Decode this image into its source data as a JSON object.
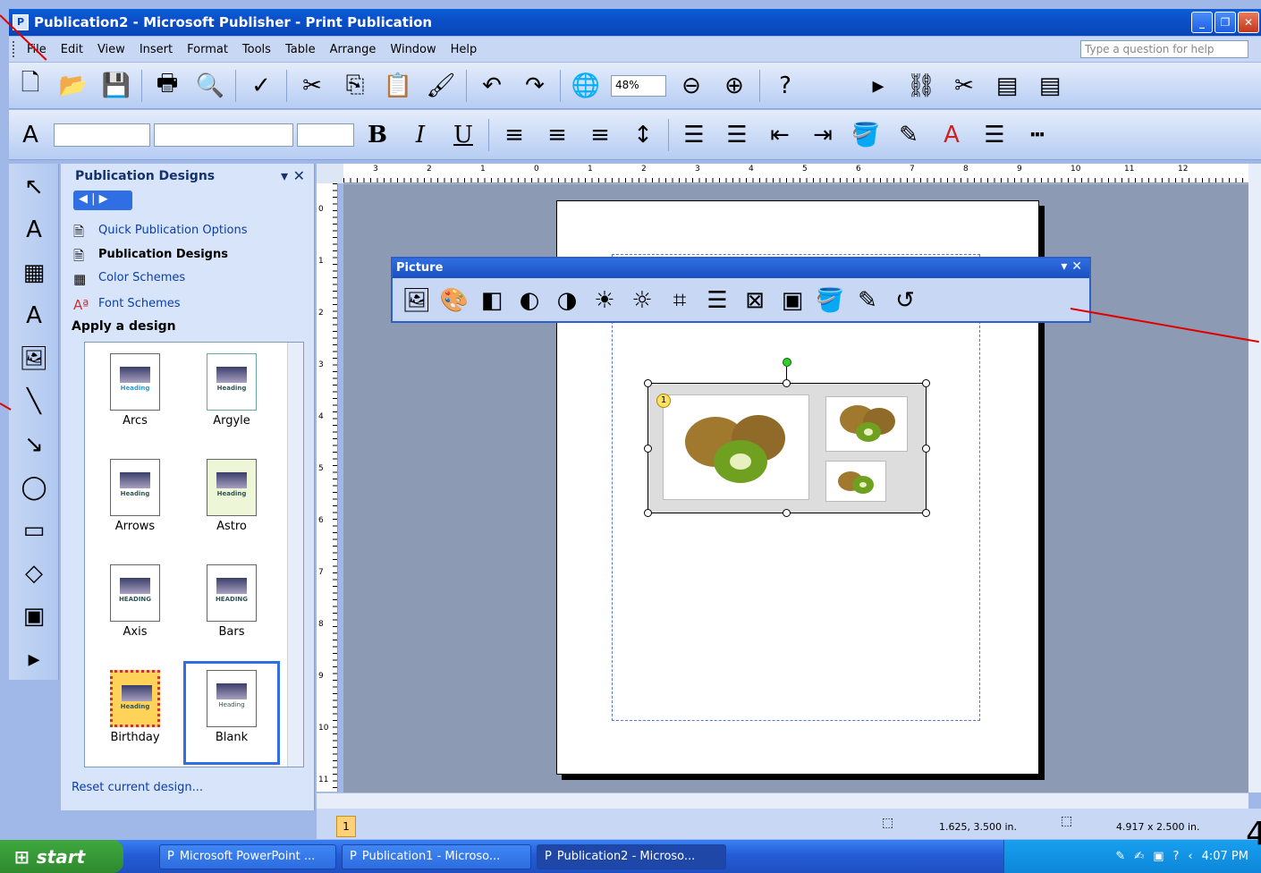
{
  "window": {
    "title": "Publication2 - Microsoft Publisher - Print Publication",
    "app_icon": "publisher-icon"
  },
  "menu": {
    "items": [
      "File",
      "Edit",
      "View",
      "Insert",
      "Format",
      "Tools",
      "Table",
      "Arrange",
      "Window",
      "Help"
    ],
    "help_placeholder": "Type a question for help"
  },
  "standard_toolbar": {
    "zoom": "48%"
  },
  "formatting_toolbar": {
    "bold": "B",
    "italic": "I",
    "underline": "U"
  },
  "task_pane": {
    "title": "Publication Designs",
    "links": [
      "Quick Publication Options",
      "Publication Designs",
      "Color Schemes",
      "Font Schemes"
    ],
    "section": "Apply a design",
    "designs": [
      "Arcs",
      "Argyle",
      "Arrows",
      "Astro",
      "Axis",
      "Bars",
      "Birthday",
      "Blank"
    ],
    "selected_design": "Blank",
    "thumb_heading": "Heading",
    "thumb_heading_caps": "HEADING",
    "reset": "Reset current design..."
  },
  "picture_toolbar": {
    "title": "Picture"
  },
  "rulers": {
    "horizontal": [
      "3",
      "2",
      "1",
      "0",
      "1",
      "2",
      "3",
      "4",
      "5",
      "6",
      "7",
      "8",
      "9",
      "10",
      "11",
      "12"
    ],
    "vertical": [
      "0",
      "1",
      "2",
      "3",
      "4",
      "5",
      "6",
      "7",
      "8",
      "9",
      "10",
      "11"
    ]
  },
  "status": {
    "page": "1",
    "position": "1.625, 3.500 in.",
    "size": "4.917 x 2.500 in."
  },
  "badge": "1",
  "taskbar": {
    "start": "start",
    "tasks": [
      "Microsoft PowerPoint ...",
      "Publication1 - Microso...",
      "Publication2 - Microso..."
    ],
    "active_task": "Publication2 - Microso...",
    "clock": "4:07 PM"
  },
  "slide_number": "4",
  "colors": {
    "title_bar": "#0b4fc8",
    "annotation_arrow": "#e00000",
    "workspace": "#8d9ab4",
    "taskbar": "#245dd7"
  }
}
